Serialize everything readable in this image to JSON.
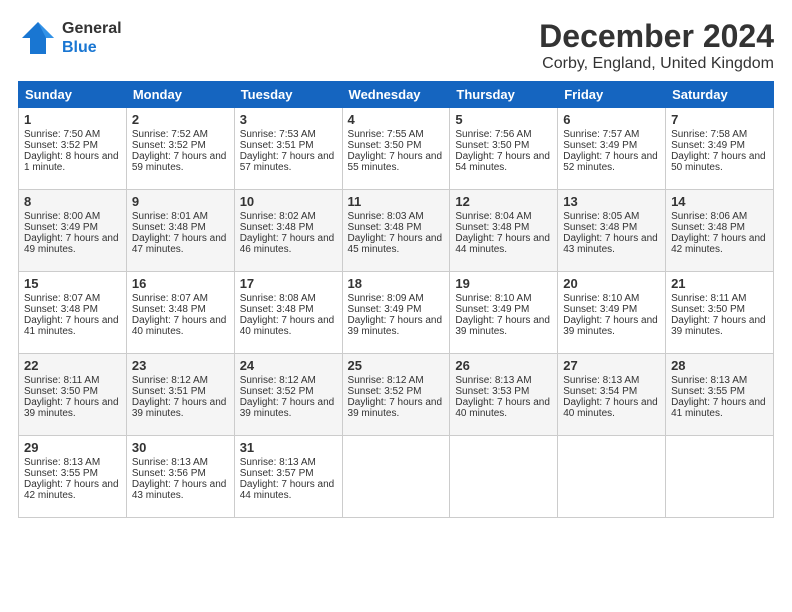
{
  "header": {
    "logo_general": "General",
    "logo_blue": "Blue",
    "title": "December 2024",
    "subtitle": "Corby, England, United Kingdom"
  },
  "weekdays": [
    "Sunday",
    "Monday",
    "Tuesday",
    "Wednesday",
    "Thursday",
    "Friday",
    "Saturday"
  ],
  "weeks": [
    [
      {
        "day": "1",
        "sunrise": "Sunrise: 7:50 AM",
        "sunset": "Sunset: 3:52 PM",
        "daylight": "Daylight: 8 hours and 1 minute."
      },
      {
        "day": "2",
        "sunrise": "Sunrise: 7:52 AM",
        "sunset": "Sunset: 3:52 PM",
        "daylight": "Daylight: 7 hours and 59 minutes."
      },
      {
        "day": "3",
        "sunrise": "Sunrise: 7:53 AM",
        "sunset": "Sunset: 3:51 PM",
        "daylight": "Daylight: 7 hours and 57 minutes."
      },
      {
        "day": "4",
        "sunrise": "Sunrise: 7:55 AM",
        "sunset": "Sunset: 3:50 PM",
        "daylight": "Daylight: 7 hours and 55 minutes."
      },
      {
        "day": "5",
        "sunrise": "Sunrise: 7:56 AM",
        "sunset": "Sunset: 3:50 PM",
        "daylight": "Daylight: 7 hours and 54 minutes."
      },
      {
        "day": "6",
        "sunrise": "Sunrise: 7:57 AM",
        "sunset": "Sunset: 3:49 PM",
        "daylight": "Daylight: 7 hours and 52 minutes."
      },
      {
        "day": "7",
        "sunrise": "Sunrise: 7:58 AM",
        "sunset": "Sunset: 3:49 PM",
        "daylight": "Daylight: 7 hours and 50 minutes."
      }
    ],
    [
      {
        "day": "8",
        "sunrise": "Sunrise: 8:00 AM",
        "sunset": "Sunset: 3:49 PM",
        "daylight": "Daylight: 7 hours and 49 minutes."
      },
      {
        "day": "9",
        "sunrise": "Sunrise: 8:01 AM",
        "sunset": "Sunset: 3:48 PM",
        "daylight": "Daylight: 7 hours and 47 minutes."
      },
      {
        "day": "10",
        "sunrise": "Sunrise: 8:02 AM",
        "sunset": "Sunset: 3:48 PM",
        "daylight": "Daylight: 7 hours and 46 minutes."
      },
      {
        "day": "11",
        "sunrise": "Sunrise: 8:03 AM",
        "sunset": "Sunset: 3:48 PM",
        "daylight": "Daylight: 7 hours and 45 minutes."
      },
      {
        "day": "12",
        "sunrise": "Sunrise: 8:04 AM",
        "sunset": "Sunset: 3:48 PM",
        "daylight": "Daylight: 7 hours and 44 minutes."
      },
      {
        "day": "13",
        "sunrise": "Sunrise: 8:05 AM",
        "sunset": "Sunset: 3:48 PM",
        "daylight": "Daylight: 7 hours and 43 minutes."
      },
      {
        "day": "14",
        "sunrise": "Sunrise: 8:06 AM",
        "sunset": "Sunset: 3:48 PM",
        "daylight": "Daylight: 7 hours and 42 minutes."
      }
    ],
    [
      {
        "day": "15",
        "sunrise": "Sunrise: 8:07 AM",
        "sunset": "Sunset: 3:48 PM",
        "daylight": "Daylight: 7 hours and 41 minutes."
      },
      {
        "day": "16",
        "sunrise": "Sunrise: 8:07 AM",
        "sunset": "Sunset: 3:48 PM",
        "daylight": "Daylight: 7 hours and 40 minutes."
      },
      {
        "day": "17",
        "sunrise": "Sunrise: 8:08 AM",
        "sunset": "Sunset: 3:48 PM",
        "daylight": "Daylight: 7 hours and 40 minutes."
      },
      {
        "day": "18",
        "sunrise": "Sunrise: 8:09 AM",
        "sunset": "Sunset: 3:49 PM",
        "daylight": "Daylight: 7 hours and 39 minutes."
      },
      {
        "day": "19",
        "sunrise": "Sunrise: 8:10 AM",
        "sunset": "Sunset: 3:49 PM",
        "daylight": "Daylight: 7 hours and 39 minutes."
      },
      {
        "day": "20",
        "sunrise": "Sunrise: 8:10 AM",
        "sunset": "Sunset: 3:49 PM",
        "daylight": "Daylight: 7 hours and 39 minutes."
      },
      {
        "day": "21",
        "sunrise": "Sunrise: 8:11 AM",
        "sunset": "Sunset: 3:50 PM",
        "daylight": "Daylight: 7 hours and 39 minutes."
      }
    ],
    [
      {
        "day": "22",
        "sunrise": "Sunrise: 8:11 AM",
        "sunset": "Sunset: 3:50 PM",
        "daylight": "Daylight: 7 hours and 39 minutes."
      },
      {
        "day": "23",
        "sunrise": "Sunrise: 8:12 AM",
        "sunset": "Sunset: 3:51 PM",
        "daylight": "Daylight: 7 hours and 39 minutes."
      },
      {
        "day": "24",
        "sunrise": "Sunrise: 8:12 AM",
        "sunset": "Sunset: 3:52 PM",
        "daylight": "Daylight: 7 hours and 39 minutes."
      },
      {
        "day": "25",
        "sunrise": "Sunrise: 8:12 AM",
        "sunset": "Sunset: 3:52 PM",
        "daylight": "Daylight: 7 hours and 39 minutes."
      },
      {
        "day": "26",
        "sunrise": "Sunrise: 8:13 AM",
        "sunset": "Sunset: 3:53 PM",
        "daylight": "Daylight: 7 hours and 40 minutes."
      },
      {
        "day": "27",
        "sunrise": "Sunrise: 8:13 AM",
        "sunset": "Sunset: 3:54 PM",
        "daylight": "Daylight: 7 hours and 40 minutes."
      },
      {
        "day": "28",
        "sunrise": "Sunrise: 8:13 AM",
        "sunset": "Sunset: 3:55 PM",
        "daylight": "Daylight: 7 hours and 41 minutes."
      }
    ],
    [
      {
        "day": "29",
        "sunrise": "Sunrise: 8:13 AM",
        "sunset": "Sunset: 3:55 PM",
        "daylight": "Daylight: 7 hours and 42 minutes."
      },
      {
        "day": "30",
        "sunrise": "Sunrise: 8:13 AM",
        "sunset": "Sunset: 3:56 PM",
        "daylight": "Daylight: 7 hours and 43 minutes."
      },
      {
        "day": "31",
        "sunrise": "Sunrise: 8:13 AM",
        "sunset": "Sunset: 3:57 PM",
        "daylight": "Daylight: 7 hours and 44 minutes."
      },
      null,
      null,
      null,
      null
    ]
  ]
}
